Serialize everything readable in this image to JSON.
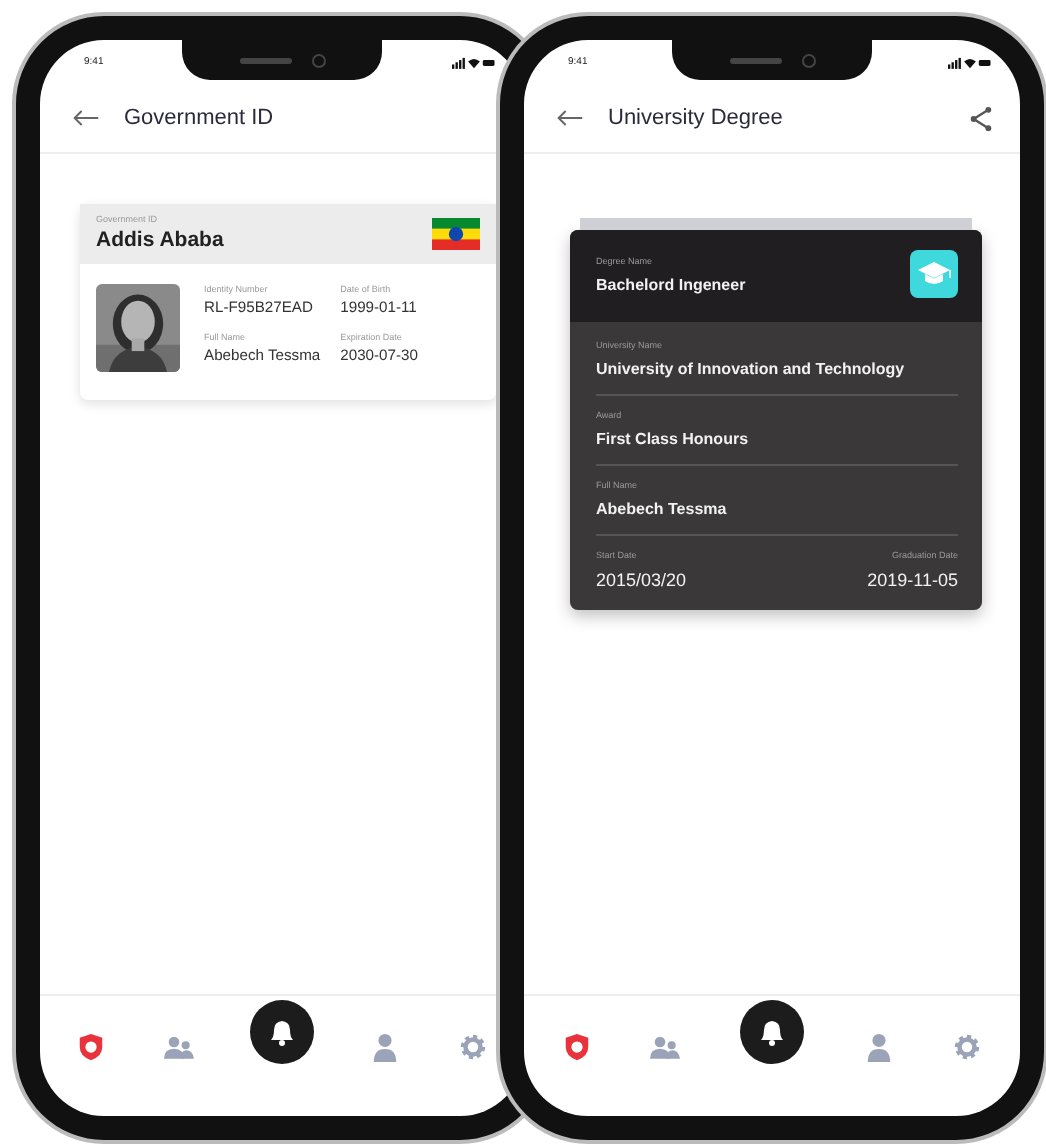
{
  "id_phone": {
    "status_time": "9:41",
    "title": "Government ID",
    "card": {
      "label": "Government ID",
      "city": "Addis Ababa",
      "fields": [
        {
          "label": "Identity Number",
          "value": "RL-F95B27EAD"
        },
        {
          "label": "Date of Birth",
          "value": "1999-01-11"
        },
        {
          "label": "Full Name",
          "value": "Abebech Tessma"
        },
        {
          "label": "Expiration Date",
          "value": "2030-07-30"
        }
      ]
    },
    "tabs": [
      {
        "selected": true
      },
      {
        "selected": false
      },
      {
        "selected": false
      },
      {
        "selected": false
      },
      {
        "selected": false
      }
    ]
  },
  "degree_phone": {
    "status_time": "9:41",
    "title": "University Degree",
    "card": {
      "label": "Degree Name",
      "value": "Bachelord Ingeneer",
      "rows": [
        {
          "label": "University Name",
          "value": "University of Innovation and Technology"
        },
        {
          "label": "Award",
          "value": "First Class Honours"
        },
        {
          "label": "Full Name",
          "value": "Abebech Tessma"
        }
      ],
      "dates": [
        {
          "label": "Start Date",
          "value": "2015/03/20"
        },
        {
          "label": "Graduation Date",
          "value": "2019-11-05"
        }
      ]
    },
    "tabs": [
      {
        "selected": true
      },
      {
        "selected": false
      },
      {
        "selected": false
      },
      {
        "selected": false
      },
      {
        "selected": false
      }
    ]
  }
}
